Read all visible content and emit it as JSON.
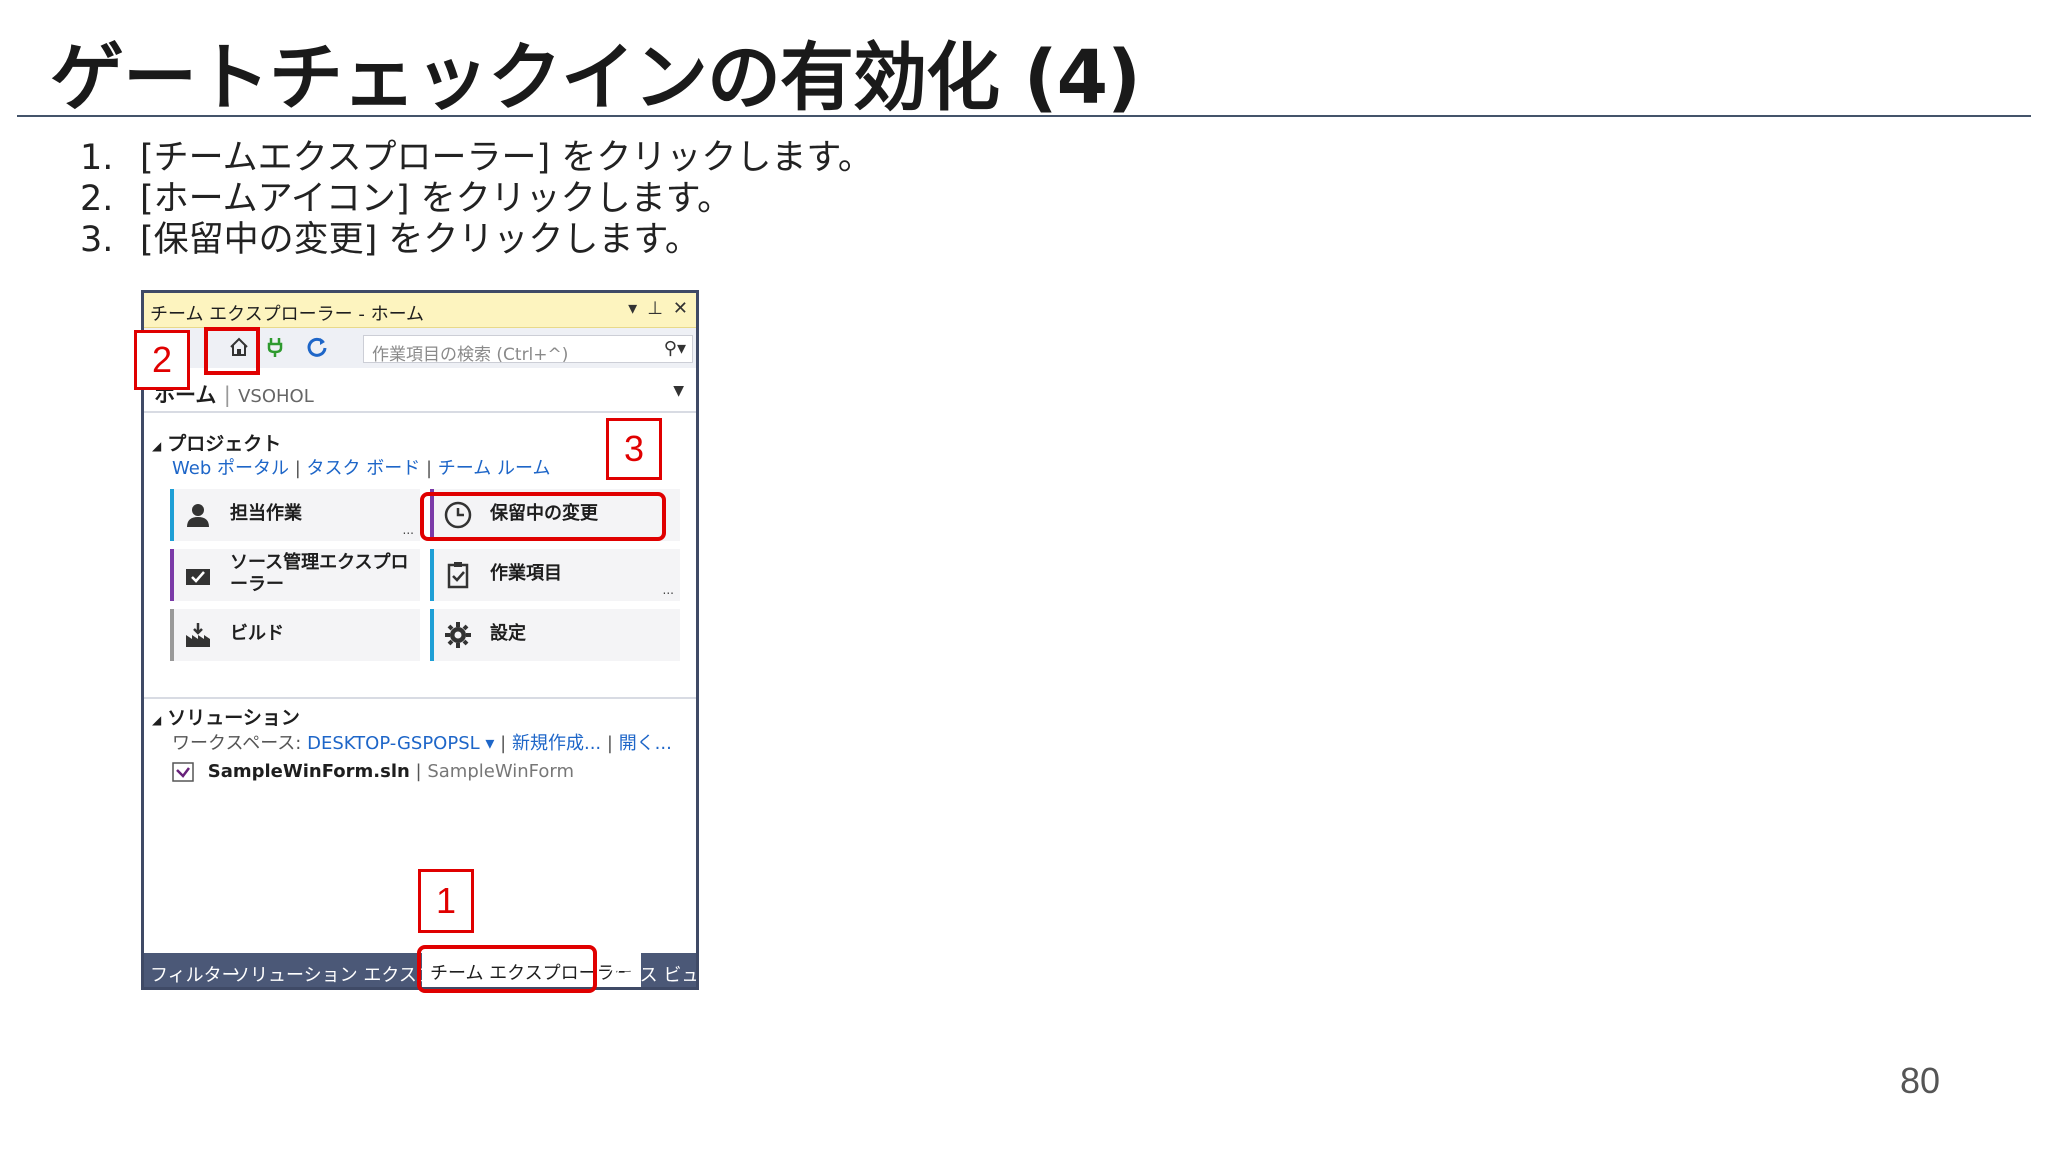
{
  "slide": {
    "title": "ゲートチェックインの有効化 (4)",
    "page_number": "80",
    "steps": [
      {
        "num": "1.",
        "text": "[チームエクスプローラー] をクリックします。"
      },
      {
        "num": "2.",
        "text": "[ホームアイコン] をクリックします。"
      },
      {
        "num": "3.",
        "text": "[保留中の変更] をクリックします。"
      }
    ]
  },
  "panel": {
    "title": "チーム エクスプローラー - ホーム",
    "search_placeholder": "作業項目の検索 (Ctrl+^)",
    "page_label": "ホーム",
    "page_separator": "|",
    "server": "VSOHOL",
    "project_header": "プロジェクト",
    "project_links": [
      "Web ポータル",
      "タスク ボード",
      "チーム ルーム"
    ],
    "tiles": {
      "my_work": "担当作業",
      "pending_changes": "保留中の変更",
      "source_control": "ソース管理エクスプローラー",
      "work_items": "作業項目",
      "builds": "ビルド",
      "settings": "設定",
      "dots": "..."
    },
    "solution_header": "ソリューション",
    "workspace_label": "ワークスペース:",
    "workspace_value": "DESKTOP-GSPOPSL",
    "new_link": "新規作成...",
    "open_link": "開く...",
    "solution_file": "SampleWinForm.sln",
    "solution_path": "SampleWinForm",
    "tabs": [
      "フィルター",
      "ソリューション エクスプ...",
      "チーム エクスプローラー",
      "クラス ビュー"
    ]
  },
  "annotations": {
    "n1": "1",
    "n2": "2",
    "n3": "3"
  },
  "colors": {
    "accent_red": "#e00000",
    "title_bar": "#fdf4bf",
    "tab_bar": "#4b5877",
    "link": "#1e66c8"
  }
}
